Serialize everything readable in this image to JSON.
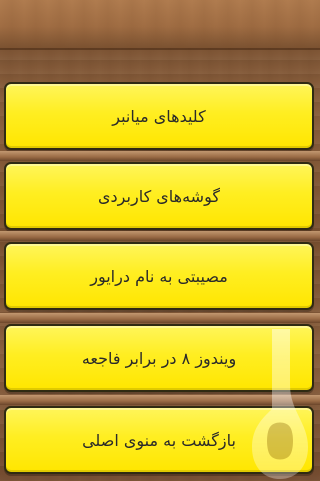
{
  "menu": {
    "items": [
      {
        "label": "کلیدهای میانبر"
      },
      {
        "label": "گوشه‌های کاربردی"
      },
      {
        "label": "مصیبتی به نام درایور"
      },
      {
        "label": "ویندوز ۸ در برابر فاجعه"
      },
      {
        "label": "بازگشت به منوی اصلی"
      }
    ]
  },
  "colors": {
    "button_fill": "#ffe600",
    "button_border": "#2f2a12",
    "wood_dark": "#7a5233",
    "wood_light": "#b07c4f",
    "text": "#2a2a2a"
  },
  "watermark": {
    "icon": "bale-logo-icon"
  }
}
